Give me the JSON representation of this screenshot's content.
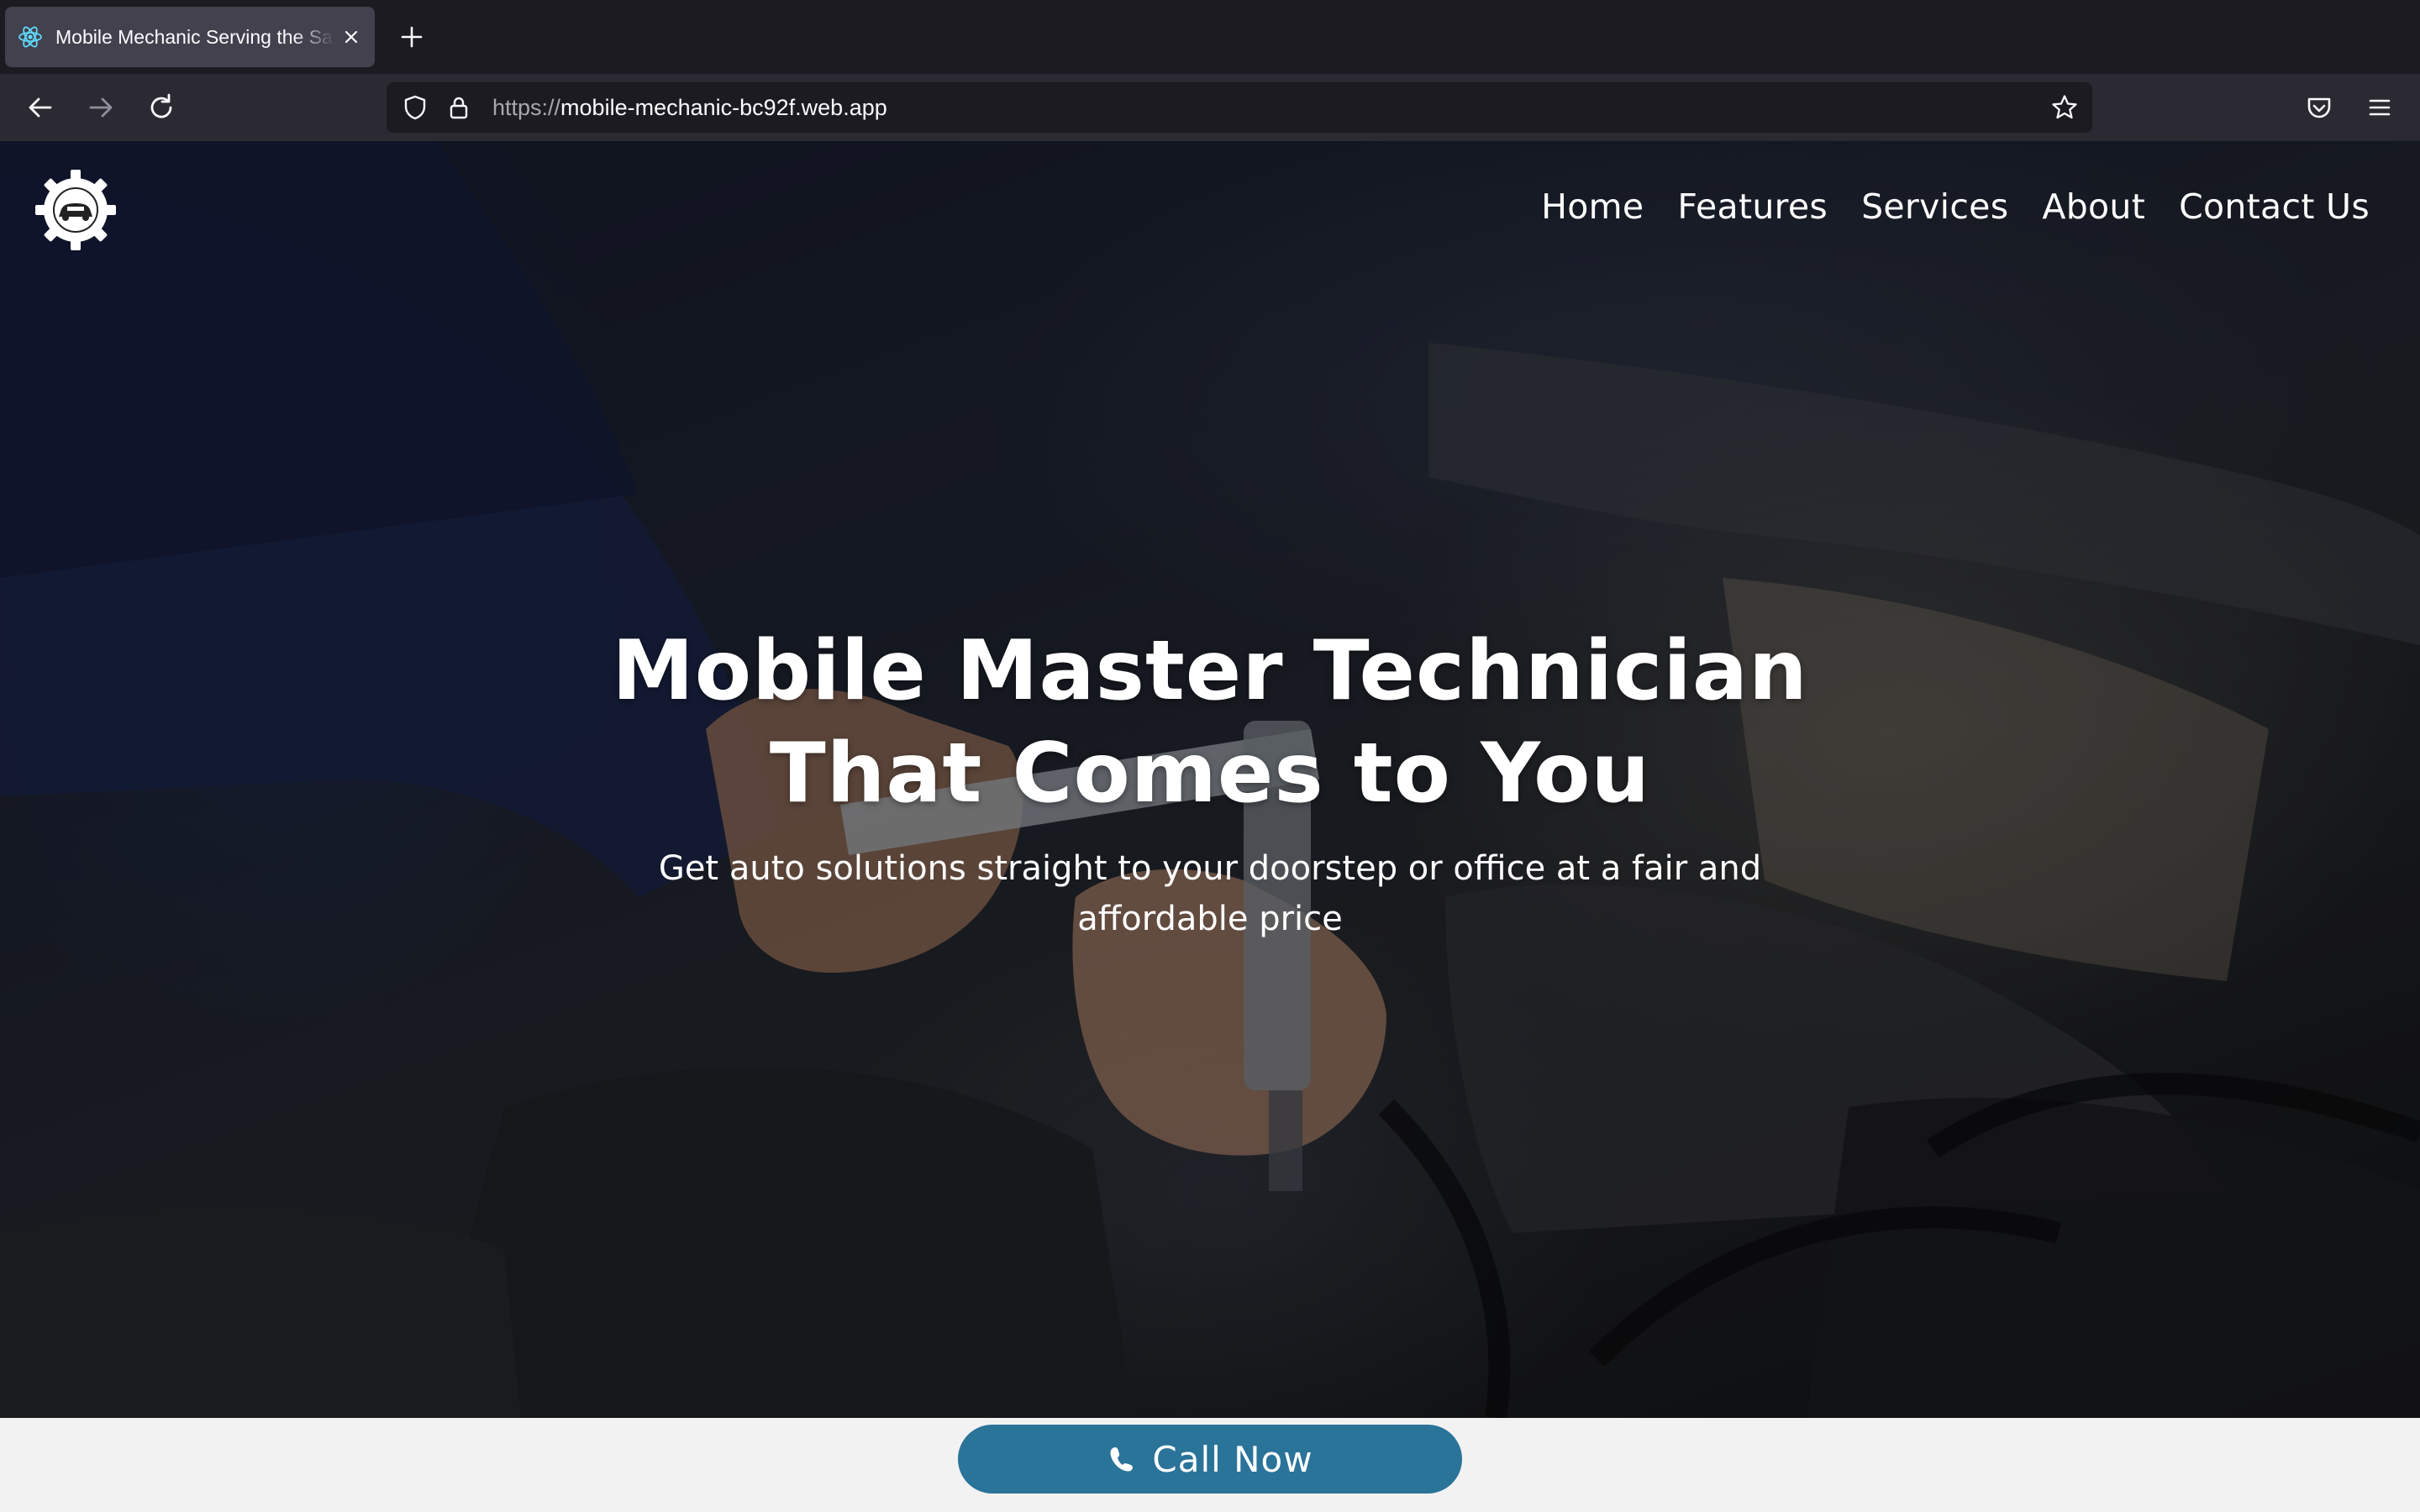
{
  "browser": {
    "tab": {
      "title": "Mobile Mechanic Serving the Sa",
      "favicon": "react-atom-icon"
    },
    "url": {
      "protocol": "https://",
      "host": "mobile-mechanic-bc92f.web.app"
    },
    "icons": {
      "back": "arrow-left-icon",
      "forward": "arrow-right-icon",
      "reload": "reload-icon",
      "tracking": "shield-icon",
      "lock": "lock-icon",
      "bookmark": "star-icon",
      "pocket": "pocket-icon",
      "menu": "hamburger-menu-icon"
    },
    "colors": {
      "tabbar": "#1c1b22",
      "toolbar": "#2b2a33",
      "active_tab": "#42414d"
    }
  },
  "site": {
    "nav": {
      "items": [
        "Home",
        "Features",
        "Services",
        "About",
        "Contact Us"
      ]
    },
    "hero": {
      "title_line1": "Mobile Master Technician",
      "title_line2": "That Comes to You",
      "subtitle": "Get auto solutions straight to your doorstep or office at a fair and affordable price"
    },
    "cta": {
      "label": "Call Now",
      "icon": "phone-icon",
      "color": "#2a7399"
    }
  }
}
